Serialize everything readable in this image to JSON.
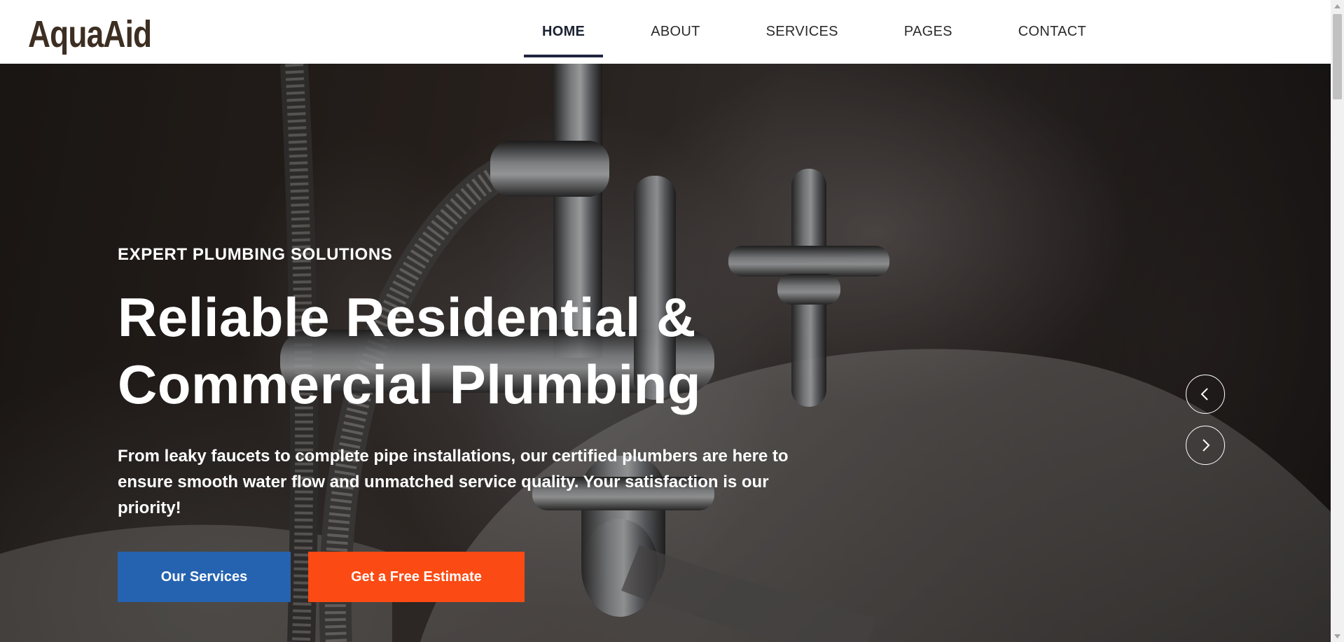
{
  "brand": {
    "logo_text": "AquaAid",
    "logo_color": "#3d2e22"
  },
  "nav": {
    "items": [
      {
        "label": "HOME",
        "active": true
      },
      {
        "label": "ABOUT",
        "active": false
      },
      {
        "label": "SERVICES",
        "active": false
      },
      {
        "label": "PAGES",
        "active": false
      },
      {
        "label": "CONTACT",
        "active": false
      }
    ],
    "active_indicator_color": "#1f2540"
  },
  "hero": {
    "eyebrow": "EXPERT PLUMBING SOLUTIONS",
    "title_line1": "Reliable Residential &",
    "title_line2": "Commercial Plumbing",
    "description": "From leaky faucets to complete pipe installations, our certified plumbers are here to ensure smooth water flow and unmatched service quality. Your satisfaction is our priority!",
    "primary_button": "Our Services",
    "secondary_button": "Get a Free Estimate",
    "primary_button_color": "#2563b0",
    "secondary_button_color": "#fb4a13",
    "background_image": "chrome-bathroom-faucet-photo",
    "prev_icon": "chevron-left-icon",
    "next_icon": "chevron-right-icon"
  }
}
